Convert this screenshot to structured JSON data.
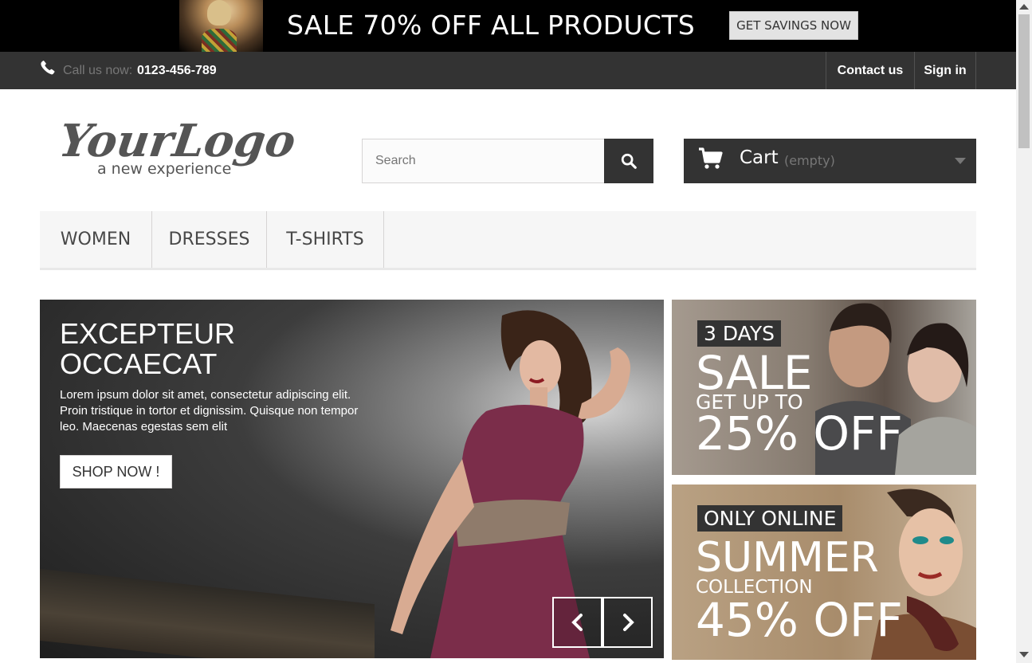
{
  "promo": {
    "text": "SALE 70% OFF ALL PRODUCTS",
    "button": "GET SAVINGS NOW"
  },
  "topbar": {
    "call_label": "Call us now:",
    "call_number": "0123-456-789",
    "contact": "Contact us",
    "signin": "Sign in"
  },
  "logo": {
    "main": "YourLogo",
    "tagline": "a new experience"
  },
  "search": {
    "placeholder": "Search",
    "value": ""
  },
  "cart": {
    "label": "Cart",
    "status": "(empty)"
  },
  "menu": {
    "items": [
      {
        "label": "WOMEN"
      },
      {
        "label": "DRESSES"
      },
      {
        "label": "T-SHIRTS"
      }
    ]
  },
  "slider": {
    "title": "EXCEPTEUR\nOCCAECAT",
    "description": "Lorem ipsum dolor sit amet, consectetur adipiscing elit. Proin tristique in tortor et dignissim. Quisque non tempor leo. Maecenas egestas sem elit",
    "button": "SHOP NOW !"
  },
  "banners": [
    {
      "tag": "3 DAYS",
      "headline": "SALE",
      "sub": "GET UP TO",
      "offer": "25% OFF"
    },
    {
      "tag": "ONLY ONLINE",
      "headline": "SUMMER",
      "sub": "COLLECTION",
      "offer": "45% OFF"
    }
  ],
  "colors": {
    "dark": "#333333",
    "menu_bg": "#f6f6f6",
    "accent_dress": "#7b2d4a"
  }
}
